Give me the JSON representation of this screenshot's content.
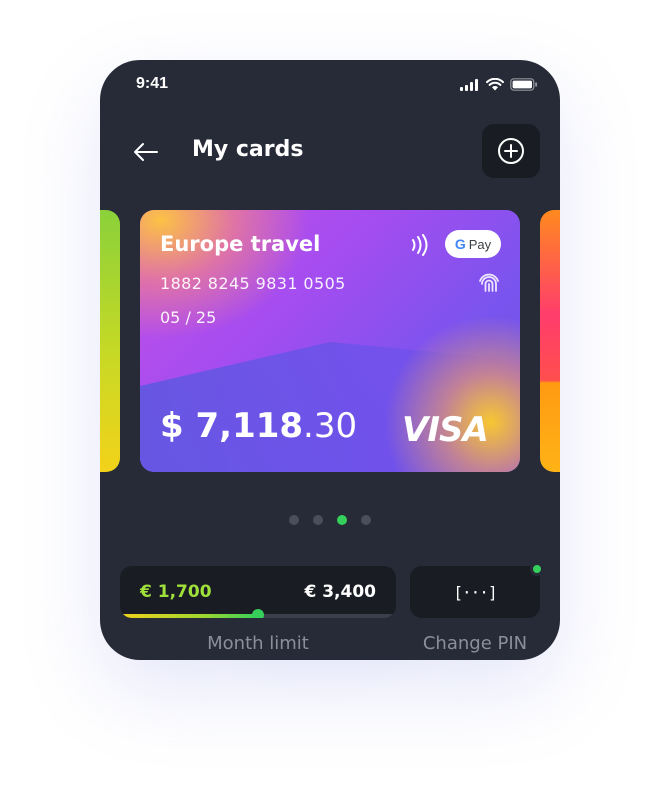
{
  "status_bar": {
    "time": "9:41"
  },
  "header": {
    "title": "My cards",
    "back_icon": "arrow-left-icon",
    "add_icon": "plus-circle-icon"
  },
  "card": {
    "name": "Europe travel",
    "number": "1882 8245 9831 0505",
    "expiry": "05 / 25",
    "balance_whole": "$ 7,118",
    "balance_cents": ".30",
    "brand": "VISA",
    "wallet_badge": {
      "g": "G",
      "text": "Pay"
    },
    "contactless_icon": "nfc-icon",
    "fingerprint_icon": "fingerprint-icon"
  },
  "carousel": {
    "count": 4,
    "active_index": 2
  },
  "month_limit": {
    "spent": "€ 1,700",
    "total": "€ 3,400",
    "progress": 0.5,
    "label": "Month limit"
  },
  "change_pin": {
    "glyph": "[···]",
    "label": "Change PIN"
  },
  "colors": {
    "background": "#262b37",
    "panel": "#191c22",
    "accent_green": "#35d05a",
    "limit_spent": "#9fe03a",
    "muted_text": "#8a8f9b"
  }
}
